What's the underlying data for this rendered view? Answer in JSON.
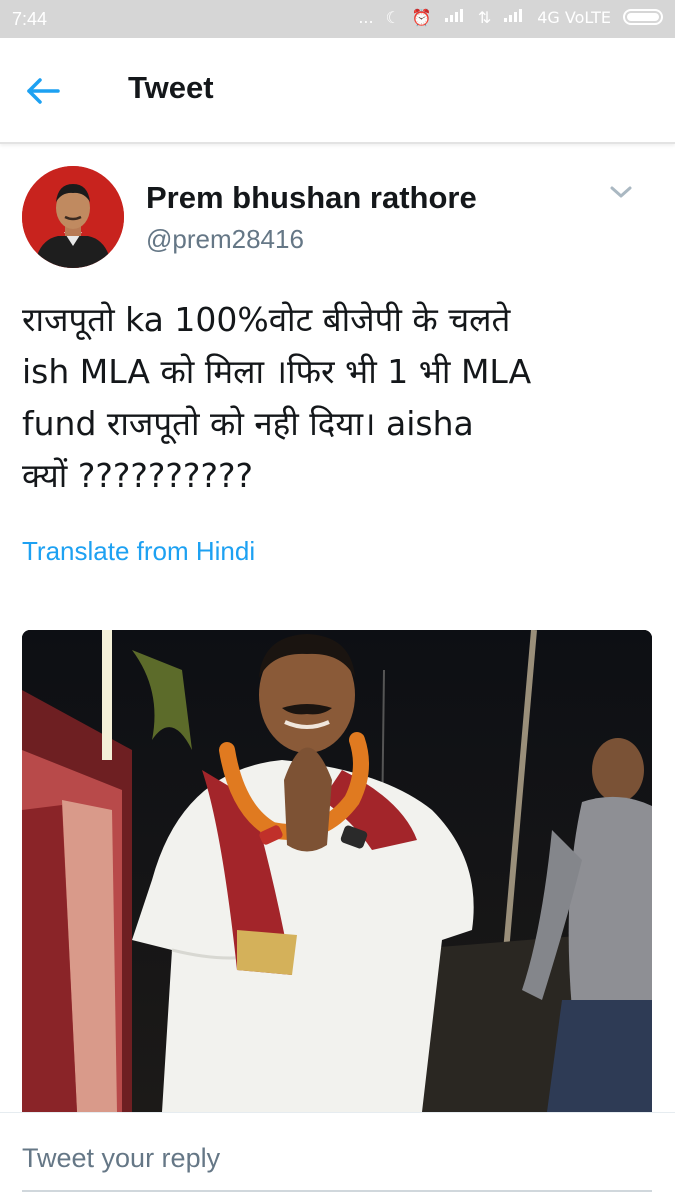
{
  "status_bar": {
    "time": "7:44",
    "dots": "...",
    "network": "4G VoLTE"
  },
  "header": {
    "title": "Tweet",
    "back_icon": "arrow-left-icon",
    "accent_color": "#1da1f2"
  },
  "tweet": {
    "display_name": "Prem bhushan rathore",
    "handle": "@prem28416",
    "text_lines": [
      "राजपूतो ka 100%वोट बीजेपी के चलते",
      "ish MLA को मिला ।फिर भी 1 भी  MLA",
      "fund राजपूतो को नही दिया।  aisha",
      "क्यों ??????????"
    ],
    "translate_label": "Translate from Hindi"
  },
  "reply": {
    "placeholder": "Tweet your reply"
  }
}
